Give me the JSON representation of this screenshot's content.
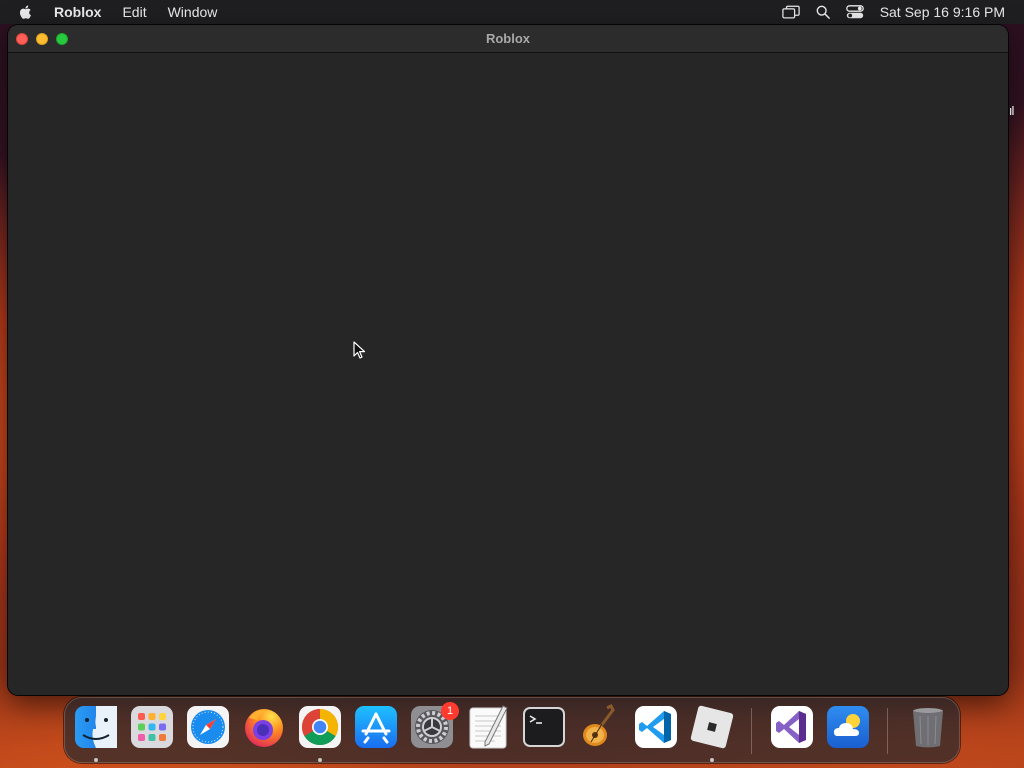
{
  "menubar": {
    "app_name": "Roblox",
    "menus": [
      "Edit",
      "Window"
    ],
    "clock": "Sat Sep 16  9:16 PM",
    "status_icons": [
      "screen-mirroring-icon",
      "spotlight-search-icon",
      "control-center-icon"
    ]
  },
  "window": {
    "title": "Roblox",
    "content_color": "#262626"
  },
  "dock": {
    "items": [
      {
        "name": "finder",
        "running": true
      },
      {
        "name": "launchpad",
        "running": false
      },
      {
        "name": "safari",
        "running": false
      },
      {
        "name": "firefox",
        "running": false
      },
      {
        "name": "chrome",
        "running": true
      },
      {
        "name": "app-store",
        "running": false
      },
      {
        "name": "system-settings",
        "running": false,
        "badge": "1"
      },
      {
        "name": "textedit",
        "running": false
      },
      {
        "name": "terminal",
        "running": false
      },
      {
        "name": "garageband",
        "running": false
      },
      {
        "name": "visual-studio-code",
        "running": false
      },
      {
        "name": "roblox",
        "running": true
      },
      {
        "name": "visual-studio",
        "running": false
      },
      {
        "name": "weather",
        "running": false
      },
      {
        "name": "trash",
        "running": false
      }
    ]
  },
  "colors": {
    "menubar_bg": "#1f1f21",
    "window_bg": "#262626",
    "close": "#fe5f57",
    "minimize": "#febc2e",
    "zoom": "#28c840",
    "badge": "#ff3b30"
  }
}
